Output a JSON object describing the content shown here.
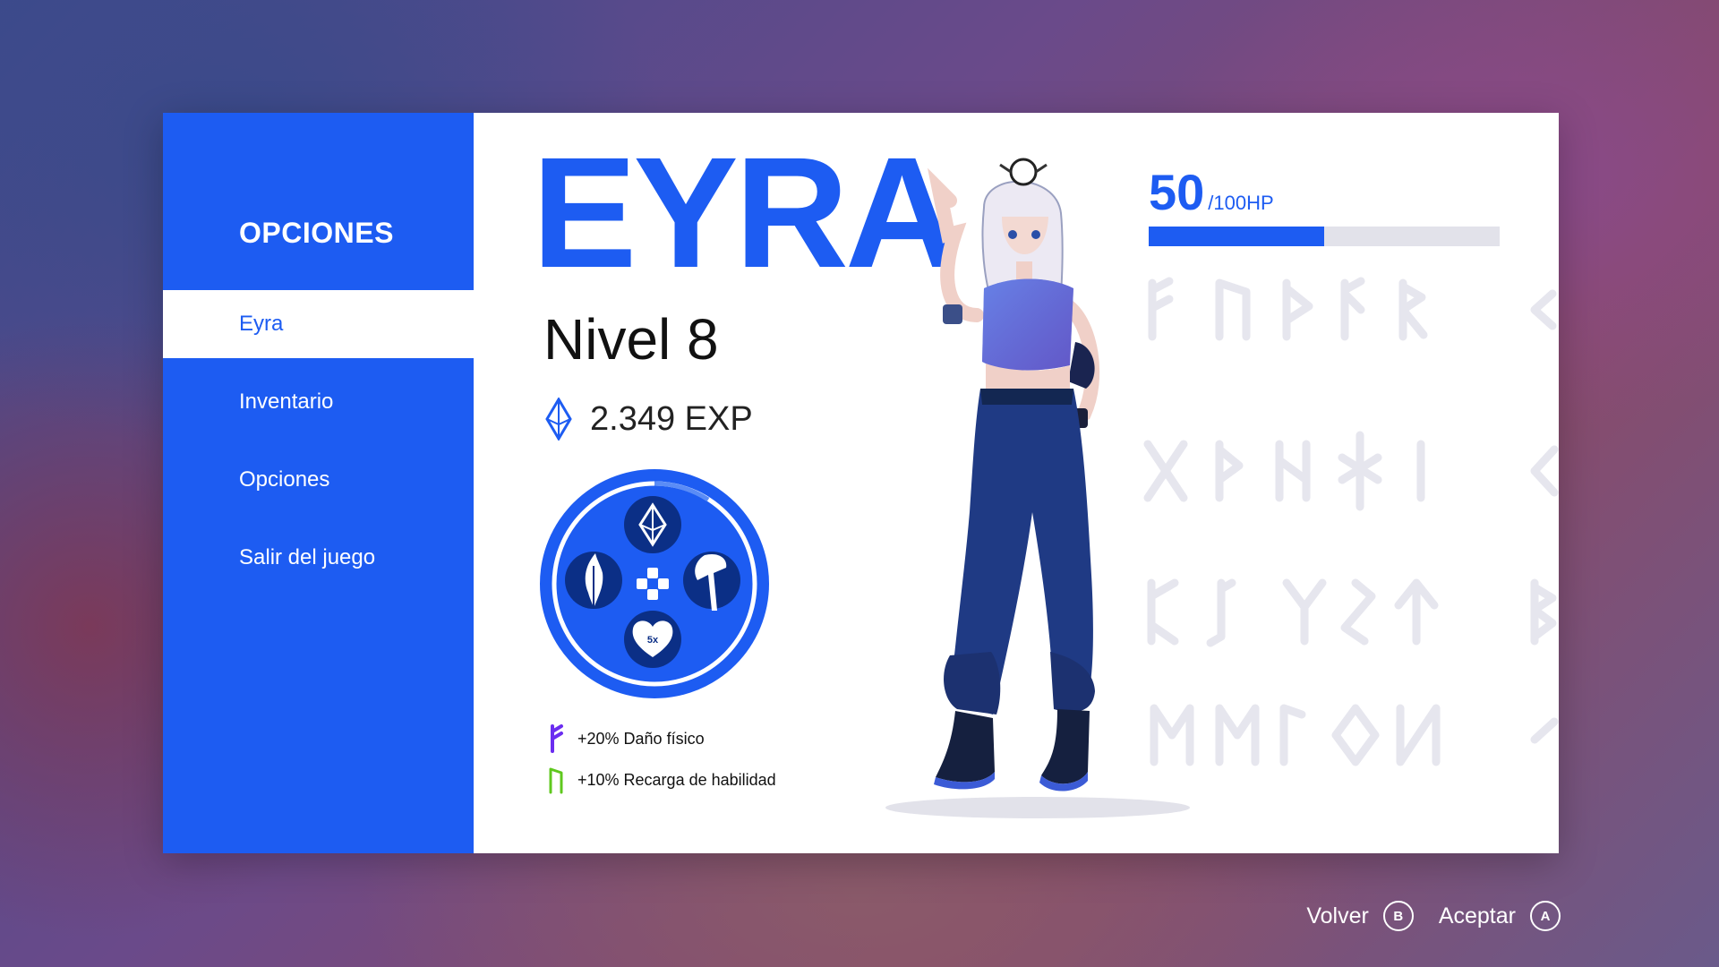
{
  "sidebar": {
    "title": "OPCIONES",
    "items": [
      {
        "label": "Eyra",
        "active": true
      },
      {
        "label": "Inventario"
      },
      {
        "label": "Opciones"
      },
      {
        "label": "Salir del juego"
      }
    ]
  },
  "character": {
    "name": "EYRA",
    "level": "Nivel 8",
    "exp": "2.349 EXP",
    "hp": {
      "current": "50",
      "max": "/100HP",
      "fraction": 0.5
    },
    "buffs": [
      {
        "label": "+20% Daño físico",
        "icon": "fehu-rune-icon",
        "color": "#6b2df0"
      },
      {
        "label": "+10% Recarga de habilidad",
        "icon": "uruz-rune-icon",
        "color": "#5fc81e"
      }
    ],
    "ability_wheel": {
      "slots": [
        "crystal-icon",
        "flame-feather-icon",
        "axe-icon",
        "heart-icon"
      ],
      "heart_count": "5x"
    }
  },
  "footer": {
    "back_label": "Volver",
    "back_button": "B",
    "accept_label": "Aceptar",
    "accept_button": "A"
  },
  "colors": {
    "accent": "#1d5cf2",
    "rune": "#e6e6ee"
  }
}
